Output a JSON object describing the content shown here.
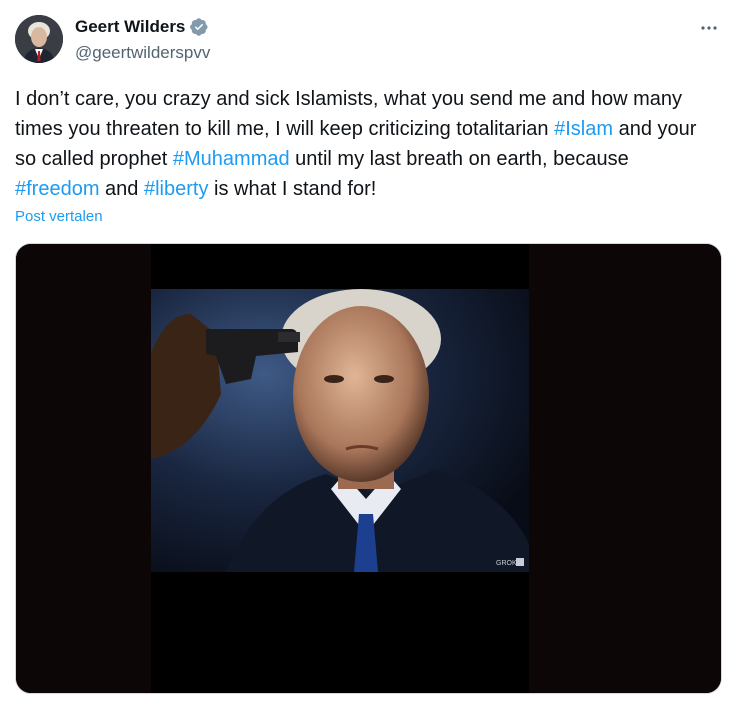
{
  "author": {
    "display_name": "Geert Wilders",
    "handle": "@geertwilderspvv",
    "verified": true,
    "verified_color": "#829aab",
    "avatar_icon": "avatar-photo"
  },
  "more_icon": "more-dots-icon",
  "tweet": {
    "segments": [
      {
        "text": "I don’t care, you crazy and sick Islamists, what you send me and how many times you threaten to kill me, I will keep criticizing totalitarian ",
        "type": "text"
      },
      {
        "text": "#Islam",
        "type": "hashtag"
      },
      {
        "text": " and your so called prophet ",
        "type": "text"
      },
      {
        "text": "#Muhammad",
        "type": "hashtag"
      },
      {
        "text": " until my last breath on earth, because ",
        "type": "text"
      },
      {
        "text": "#freedom",
        "type": "hashtag"
      },
      {
        "text": " and ",
        "type": "text"
      },
      {
        "text": "#liberty",
        "type": "hashtag"
      },
      {
        "text": " is what I stand for!",
        "type": "text"
      }
    ],
    "translate_label": "Post vertalen"
  },
  "media": {
    "watermark": "GROK",
    "description_icon": "embedded-image"
  },
  "colors": {
    "link": "#1d9bf0",
    "text": "#0f1419",
    "secondary": "#536471"
  }
}
